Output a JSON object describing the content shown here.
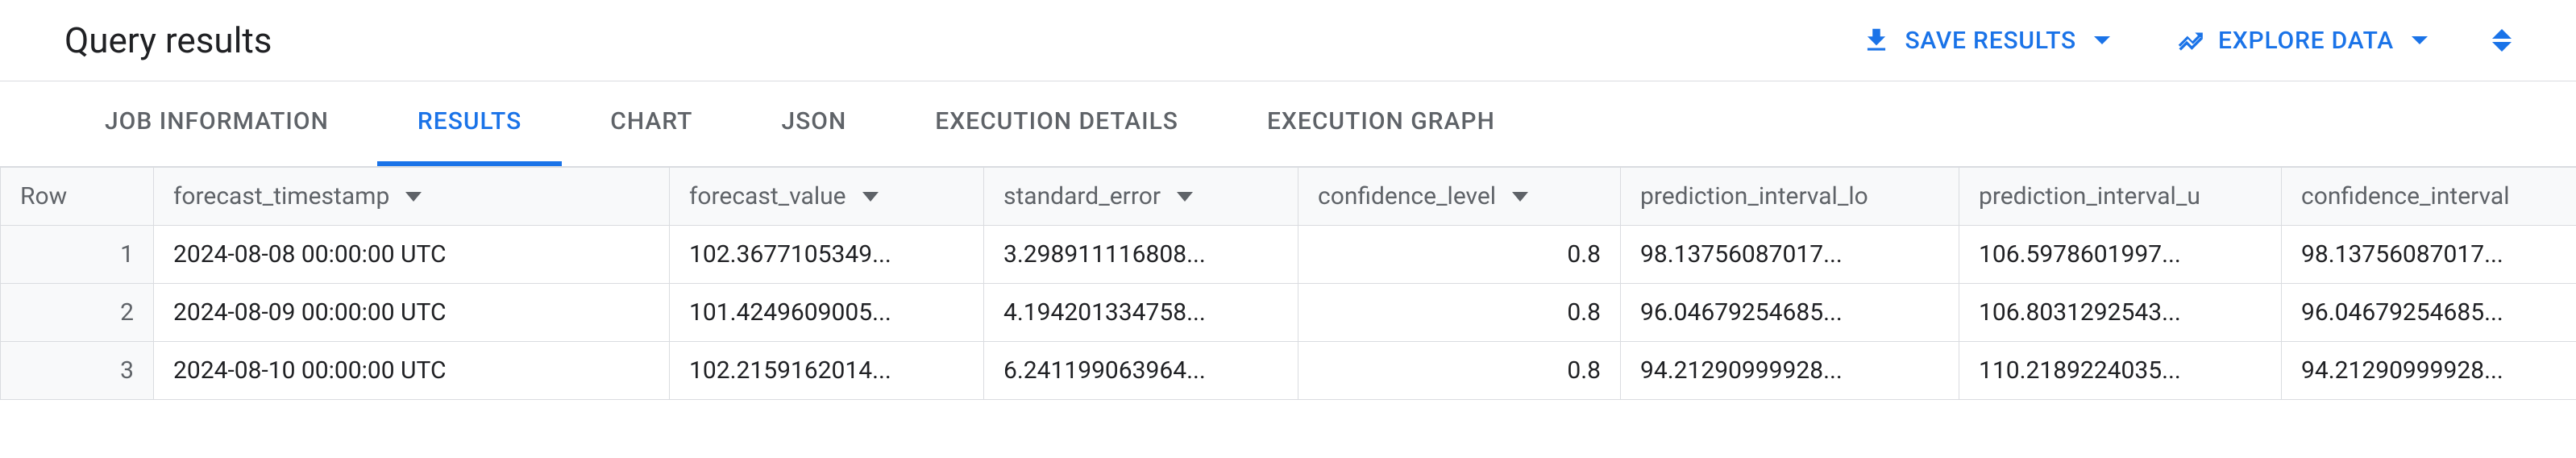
{
  "header": {
    "title": "Query results",
    "save_results_label": "SAVE RESULTS",
    "explore_data_label": "EXPLORE DATA"
  },
  "tabs": [
    {
      "label": "JOB INFORMATION",
      "active": false
    },
    {
      "label": "RESULTS",
      "active": true
    },
    {
      "label": "CHART",
      "active": false
    },
    {
      "label": "JSON",
      "active": false
    },
    {
      "label": "EXECUTION DETAILS",
      "active": false
    },
    {
      "label": "EXECUTION GRAPH",
      "active": false
    }
  ],
  "table": {
    "columns": {
      "row": "Row",
      "forecast_timestamp": "forecast_timestamp",
      "forecast_value": "forecast_value",
      "standard_error": "standard_error",
      "confidence_level": "confidence_level",
      "prediction_interval_lower": "prediction_interval_lo",
      "prediction_interval_upper": "prediction_interval_u",
      "confidence_interval": "confidence_interval"
    },
    "rows": [
      {
        "row": "1",
        "forecast_timestamp": "2024-08-08 00:00:00 UTC",
        "forecast_value": "102.3677105349...",
        "standard_error": "3.298911116808...",
        "confidence_level": "0.8",
        "prediction_interval_lower": "98.13756087017...",
        "prediction_interval_upper": "106.5978601997...",
        "confidence_interval": "98.13756087017..."
      },
      {
        "row": "2",
        "forecast_timestamp": "2024-08-09 00:00:00 UTC",
        "forecast_value": "101.4249609005...",
        "standard_error": "4.194201334758...",
        "confidence_level": "0.8",
        "prediction_interval_lower": "96.04679254685...",
        "prediction_interval_upper": "106.8031292543...",
        "confidence_interval": "96.04679254685..."
      },
      {
        "row": "3",
        "forecast_timestamp": "2024-08-10 00:00:00 UTC",
        "forecast_value": "102.2159162014...",
        "standard_error": "6.241199063964...",
        "confidence_level": "0.8",
        "prediction_interval_lower": "94.21290999928...",
        "prediction_interval_upper": "110.2189224035...",
        "confidence_interval": "94.21290999928..."
      }
    ]
  }
}
